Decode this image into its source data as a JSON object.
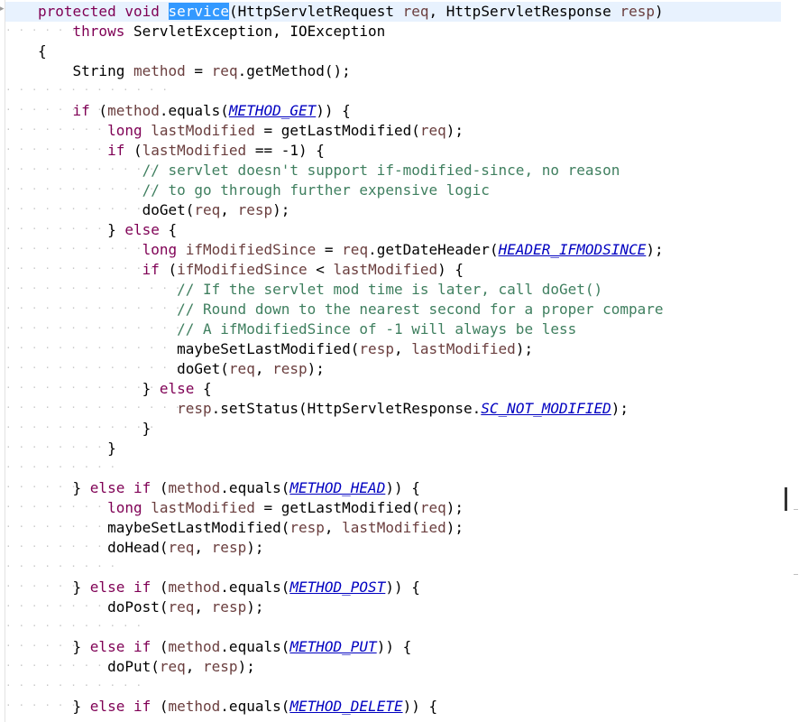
{
  "editor": {
    "lines": [
      {
        "ws": "",
        "current": true,
        "tokens": [
          {
            "t": "protected",
            "c": "kw"
          },
          {
            "t": " "
          },
          {
            "t": "void",
            "c": "kw"
          },
          {
            "t": " "
          },
          {
            "t": "service",
            "c": "sel"
          },
          {
            "t": "(HttpServletRequest "
          },
          {
            "t": "req",
            "c": "var"
          },
          {
            "t": ", HttpServletResponse "
          },
          {
            "t": "resp",
            "c": "var"
          },
          {
            "t": ")"
          }
        ]
      },
      {
        "ws": "· · · · · ·",
        "tokens": [
          {
            "t": "    "
          },
          {
            "t": "throws",
            "c": "kw"
          },
          {
            "t": " ServletException, IOException"
          }
        ]
      },
      {
        "ws": "",
        "tokens": [
          {
            "t": "{"
          }
        ]
      },
      {
        "ws": "",
        "tokens": [
          {
            "t": "    String "
          },
          {
            "t": "method",
            "c": "var"
          },
          {
            "t": " = "
          },
          {
            "t": "req",
            "c": "var"
          },
          {
            "t": ".getMethod();"
          }
        ]
      },
      {
        "ws": "· · · · · · · · · · · · ·",
        "tokens": []
      },
      {
        "ws": "· · · · · · · · ·",
        "tokens": [
          {
            "t": "    "
          },
          {
            "t": "if",
            "c": "kw"
          },
          {
            "t": " ("
          },
          {
            "t": "method",
            "c": "var"
          },
          {
            "t": ".equals("
          },
          {
            "t": "METHOD_GET",
            "c": "sf"
          },
          {
            "t": ")) {"
          }
        ]
      },
      {
        "ws": "· · · · · · · · ·",
        "tokens": [
          {
            "t": "        "
          },
          {
            "t": "long",
            "c": "kw"
          },
          {
            "t": " "
          },
          {
            "t": "lastModified",
            "c": "var"
          },
          {
            "t": " = getLastModified("
          },
          {
            "t": "req",
            "c": "var"
          },
          {
            "t": ");"
          }
        ]
      },
      {
        "ws": "· · · · · · · · ·",
        "tokens": [
          {
            "t": "        "
          },
          {
            "t": "if",
            "c": "kw"
          },
          {
            "t": " ("
          },
          {
            "t": "lastModified",
            "c": "var"
          },
          {
            "t": " == -1) {"
          }
        ]
      },
      {
        "ws": "· · · · · · · · · · · ·",
        "tokens": [
          {
            "t": "            "
          },
          {
            "t": "// servlet doesn't support if-modified-since, no reason",
            "c": "cm"
          }
        ]
      },
      {
        "ws": "· · · · · · · · · · · ·",
        "tokens": [
          {
            "t": "            "
          },
          {
            "t": "// to go through further expensive logic",
            "c": "cm"
          }
        ]
      },
      {
        "ws": "· · · · · · · · · · · ·",
        "tokens": [
          {
            "t": "            doGet("
          },
          {
            "t": "req",
            "c": "var"
          },
          {
            "t": ", "
          },
          {
            "t": "resp",
            "c": "var"
          },
          {
            "t": ");"
          }
        ]
      },
      {
        "ws": "· · · · · · · · ·",
        "tokens": [
          {
            "t": "        } "
          },
          {
            "t": "else",
            "c": "kw"
          },
          {
            "t": " {"
          }
        ]
      },
      {
        "ws": "· · · · · · · · · · · ·",
        "tokens": [
          {
            "t": "            "
          },
          {
            "t": "long",
            "c": "kw"
          },
          {
            "t": " "
          },
          {
            "t": "ifModifiedSince",
            "c": "var"
          },
          {
            "t": " = "
          },
          {
            "t": "req",
            "c": "var"
          },
          {
            "t": ".getDateHeader("
          },
          {
            "t": "HEADER_IFMODSINCE",
            "c": "sf"
          },
          {
            "t": ");"
          }
        ]
      },
      {
        "ws": "· · · · · · · · · · · ·",
        "tokens": [
          {
            "t": "            "
          },
          {
            "t": "if",
            "c": "kw"
          },
          {
            "t": " ("
          },
          {
            "t": "ifModifiedSince",
            "c": "var"
          },
          {
            "t": " < "
          },
          {
            "t": "lastModified",
            "c": "var"
          },
          {
            "t": ") {"
          }
        ]
      },
      {
        "ws": "· · · · · · · · · · · · · · ·",
        "tokens": [
          {
            "t": "                "
          },
          {
            "t": "// If the servlet mod time is later, call doGet()",
            "c": "cm"
          }
        ]
      },
      {
        "ws": "· · · · · · · · · · · · · · ·",
        "tokens": [
          {
            "t": "                "
          },
          {
            "t": "// Round down to the nearest second for a proper compare",
            "c": "cm"
          }
        ]
      },
      {
        "ws": "· · · · · · · · · · · · · · ·",
        "tokens": [
          {
            "t": "                "
          },
          {
            "t": "// A ifModifiedSince of -1 will always be less",
            "c": "cm"
          }
        ]
      },
      {
        "ws": "· · · · · · · · · · · · · · ·",
        "tokens": [
          {
            "t": "                maybeSetLastModified("
          },
          {
            "t": "resp",
            "c": "var"
          },
          {
            "t": ", "
          },
          {
            "t": "lastModified",
            "c": "var"
          },
          {
            "t": ");"
          }
        ]
      },
      {
        "ws": "· · · · · · · · · · · · · · ·",
        "tokens": [
          {
            "t": "                doGet("
          },
          {
            "t": "req",
            "c": "var"
          },
          {
            "t": ", "
          },
          {
            "t": "resp",
            "c": "var"
          },
          {
            "t": ");"
          }
        ]
      },
      {
        "ws": "· · · · · · · · · · · ·",
        "tokens": [
          {
            "t": "            } "
          },
          {
            "t": "else",
            "c": "kw"
          },
          {
            "t": " {"
          }
        ]
      },
      {
        "ws": "· · · · · · · · · · · · · · ·",
        "tokens": [
          {
            "t": "                "
          },
          {
            "t": "resp",
            "c": "var"
          },
          {
            "t": ".setStatus(HttpServletResponse."
          },
          {
            "t": "SC_NOT_MODIFIED",
            "c": "sf"
          },
          {
            "t": ");"
          }
        ]
      },
      {
        "ws": "· · · · · · · · · · · ·",
        "tokens": [
          {
            "t": "            }"
          }
        ]
      },
      {
        "ws": "· · · · · · · · ·",
        "tokens": [
          {
            "t": "        }"
          }
        ]
      },
      {
        "ws": "· · · · · · · · ·",
        "tokens": []
      },
      {
        "ws": "· · · · · ·",
        "tokens": [
          {
            "t": "    } "
          },
          {
            "t": "else",
            "c": "kw"
          },
          {
            "t": " "
          },
          {
            "t": "if",
            "c": "kw"
          },
          {
            "t": " ("
          },
          {
            "t": "method",
            "c": "var"
          },
          {
            "t": ".equals("
          },
          {
            "t": "METHOD_HEAD",
            "c": "sf"
          },
          {
            "t": ")) {"
          }
        ]
      },
      {
        "ws": "· · · · · · · · ·",
        "tokens": [
          {
            "t": "        "
          },
          {
            "t": "long",
            "c": "kw"
          },
          {
            "t": " "
          },
          {
            "t": "lastModified",
            "c": "var"
          },
          {
            "t": " = getLastModified("
          },
          {
            "t": "req",
            "c": "var"
          },
          {
            "t": ");"
          }
        ]
      },
      {
        "ws": "· · · · · · · · ·",
        "tokens": [
          {
            "t": "        maybeSetLastModified("
          },
          {
            "t": "resp",
            "c": "var"
          },
          {
            "t": ", "
          },
          {
            "t": "lastModified",
            "c": "var"
          },
          {
            "t": ");"
          }
        ]
      },
      {
        "ws": "· · · · · · · · ·",
        "tokens": [
          {
            "t": "        doHead("
          },
          {
            "t": "req",
            "c": "var"
          },
          {
            "t": ", "
          },
          {
            "t": "resp",
            "c": "var"
          },
          {
            "t": ");"
          }
        ]
      },
      {
        "ws": "· · · · · · · · ·",
        "tokens": []
      },
      {
        "ws": "· · · · · ·",
        "tokens": [
          {
            "t": "    } "
          },
          {
            "t": "else",
            "c": "kw"
          },
          {
            "t": " "
          },
          {
            "t": "if",
            "c": "kw"
          },
          {
            "t": " ("
          },
          {
            "t": "method",
            "c": "var"
          },
          {
            "t": ".equals("
          },
          {
            "t": "METHOD_POST",
            "c": "sf"
          },
          {
            "t": ")) {"
          }
        ]
      },
      {
        "ws": "· · · · · · · · ·",
        "tokens": [
          {
            "t": "        doPost("
          },
          {
            "t": "req",
            "c": "var"
          },
          {
            "t": ", "
          },
          {
            "t": "resp",
            "c": "var"
          },
          {
            "t": ");"
          }
        ]
      },
      {
        "ws": "· · · · · · · · · · ·",
        "tokens": []
      },
      {
        "ws": "· · · · · ·",
        "tokens": [
          {
            "t": "    } "
          },
          {
            "t": "else",
            "c": "kw"
          },
          {
            "t": " "
          },
          {
            "t": "if",
            "c": "kw"
          },
          {
            "t": " ("
          },
          {
            "t": "method",
            "c": "var"
          },
          {
            "t": ".equals("
          },
          {
            "t": "METHOD_PUT",
            "c": "sf"
          },
          {
            "t": ")) {"
          }
        ]
      },
      {
        "ws": "· · · · · · · · ·",
        "tokens": [
          {
            "t": "        doPut("
          },
          {
            "t": "req",
            "c": "var"
          },
          {
            "t": ", "
          },
          {
            "t": "resp",
            "c": "var"
          },
          {
            "t": ");"
          }
        ]
      },
      {
        "ws": "· · · · · · · · · · ·",
        "tokens": []
      },
      {
        "ws": "· · · · · ·",
        "tokens": [
          {
            "t": "    } "
          },
          {
            "t": "else",
            "c": "kw"
          },
          {
            "t": " "
          },
          {
            "t": "if",
            "c": "kw"
          },
          {
            "t": " ("
          },
          {
            "t": "method",
            "c": "var"
          },
          {
            "t": ".equals("
          },
          {
            "t": "METHOD_DELETE",
            "c": "sf"
          },
          {
            "t": ")) {"
          }
        ]
      }
    ]
  },
  "colors": {
    "keyword": "#7f0055",
    "variable": "#6a3e3e",
    "comment": "#3f7f5f",
    "static_field": "#0000c0",
    "selection": "#3399ff",
    "current_line": "#e8f2fe"
  }
}
